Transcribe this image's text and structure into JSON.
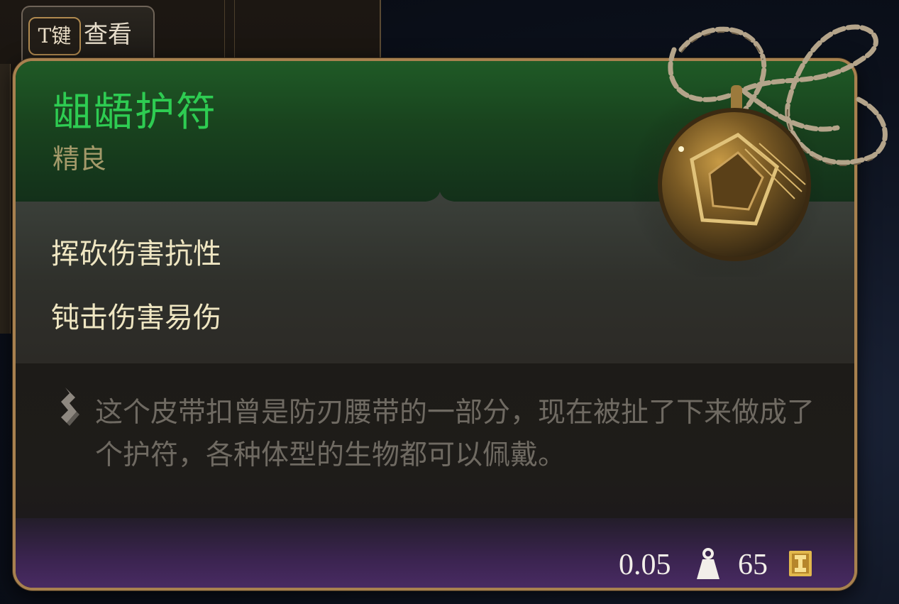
{
  "key_prompt": {
    "key": "T键",
    "label": "查看"
  },
  "item": {
    "name": "龃龉护符",
    "rarity": "精良",
    "rarity_color": "#2ecc52",
    "properties": [
      "挥砍伤害抗性",
      "钝击伤害易伤"
    ],
    "description": "这个皮带扣曾是防刃腰带的一部分，现在被扯了下来做成了个护符，各种体型的生物都可以佩戴。",
    "weight": "0.05",
    "weight_icon": "weight-icon",
    "value": "65",
    "value_icon": "gold-coin-icon",
    "description_icon": "scroll-icon",
    "image_icon": "amulet-icon"
  }
}
